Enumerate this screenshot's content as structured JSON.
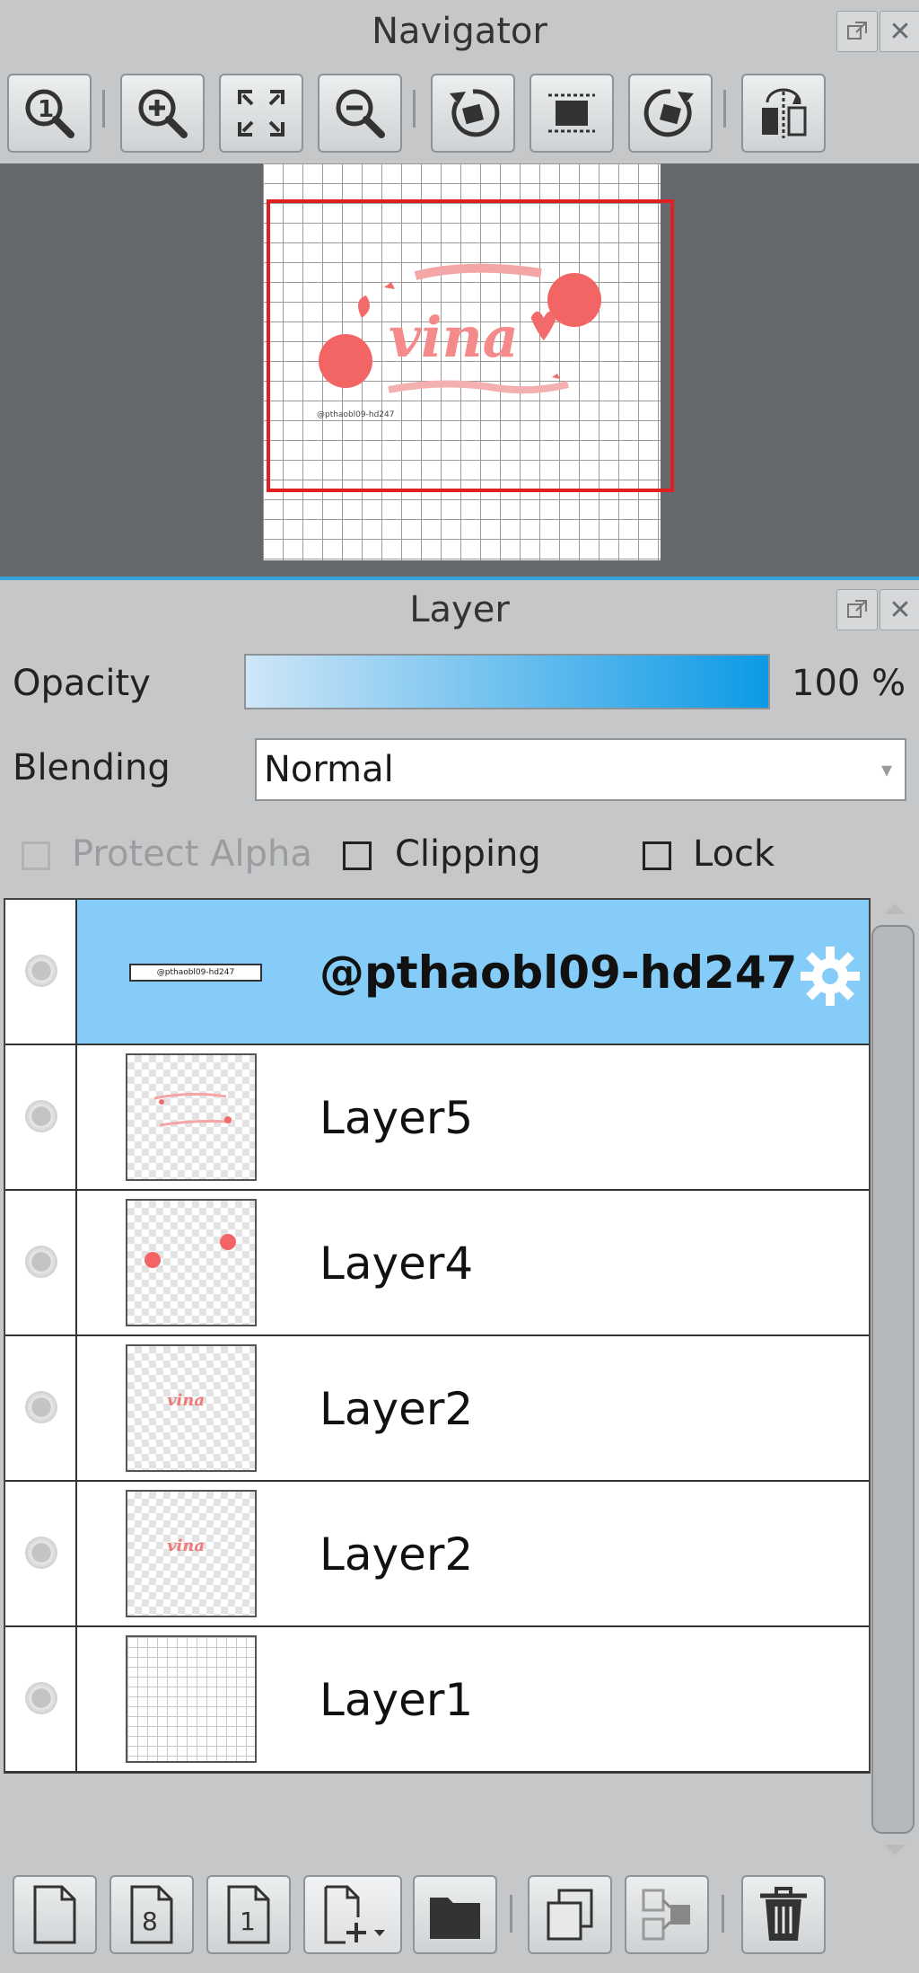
{
  "navigator": {
    "title": "Navigator",
    "toolbar": [
      {
        "name": "actual-size-button",
        "icon": "one-to-one-magnifier-icon"
      },
      {
        "name": "zoom-in-button",
        "icon": "zoom-in-icon"
      },
      {
        "name": "fit-to-window-button",
        "icon": "fit-window-icon"
      },
      {
        "name": "zoom-out-button",
        "icon": "zoom-out-icon"
      },
      {
        "name": "rotate-left-button",
        "icon": "rotate-left-icon"
      },
      {
        "name": "reset-view-button",
        "icon": "reset-view-icon"
      },
      {
        "name": "rotate-right-button",
        "icon": "rotate-right-icon"
      },
      {
        "name": "flip-horizontal-button",
        "icon": "flip-icon"
      }
    ],
    "preview": {
      "logo_text": "vina",
      "watermark": "@pthaobl09-hd247",
      "accent": "#f06a6a"
    }
  },
  "layer_panel": {
    "title": "Layer",
    "opacity_label": "Opacity",
    "opacity_value": "100 %",
    "blending_label": "Blending",
    "blending_value": "Normal",
    "protect_alpha_label": "Protect Alpha",
    "clipping_label": "Clipping",
    "lock_label": "Lock",
    "layers": [
      {
        "name": "@pthaobl09-hd247",
        "selected": true,
        "thumb": "text-strip"
      },
      {
        "name": "Layer5",
        "selected": false,
        "thumb": "ribbons"
      },
      {
        "name": "Layer4",
        "selected": false,
        "thumb": "dots"
      },
      {
        "name": "Layer2",
        "selected": false,
        "thumb": "vina-text"
      },
      {
        "name": "Layer2",
        "selected": false,
        "thumb": "vina-text"
      },
      {
        "name": "Layer1",
        "selected": false,
        "thumb": "grid"
      }
    ],
    "bottom_toolbar": [
      {
        "name": "new-layer-button",
        "icon": "new-page-icon"
      },
      {
        "name": "new-8bit-layer-button",
        "icon": "page-8-icon",
        "text": "8"
      },
      {
        "name": "new-1bit-layer-button",
        "icon": "page-1-icon",
        "text": "1"
      },
      {
        "name": "add-layer-menu-button",
        "icon": "add-page-dropdown-icon"
      },
      {
        "name": "new-folder-button",
        "icon": "folder-icon"
      },
      {
        "name": "duplicate-layer-button",
        "icon": "duplicate-icon"
      },
      {
        "name": "merge-down-button",
        "icon": "merge-icon"
      },
      {
        "name": "delete-layer-button",
        "icon": "trash-icon"
      }
    ],
    "selected_color": "#85cdf8"
  }
}
